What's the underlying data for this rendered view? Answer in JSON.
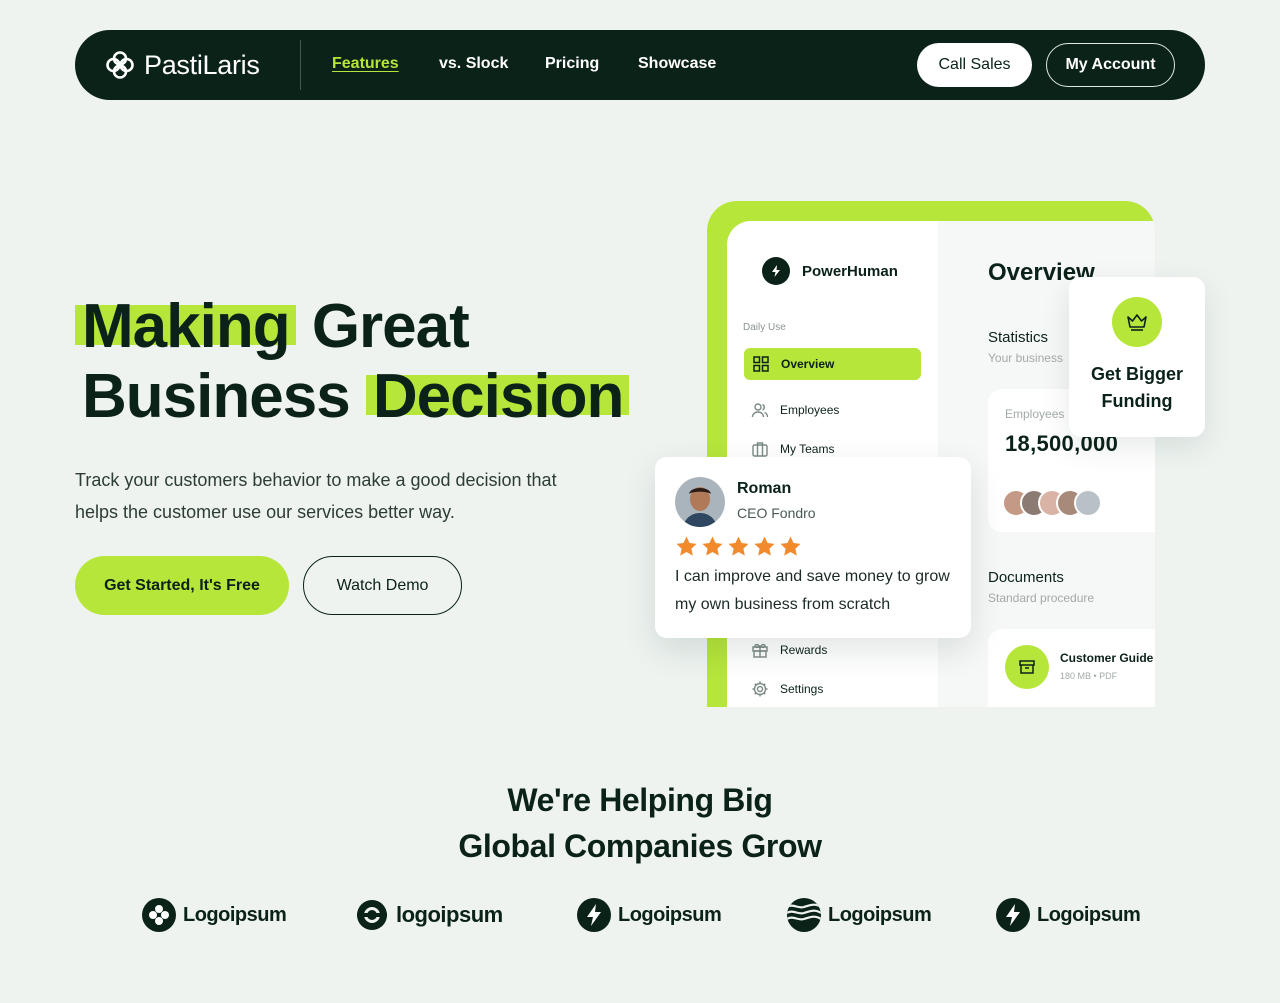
{
  "colors": {
    "accent": "#b6e63a",
    "dark": "#0b2219",
    "background": "#eef3f0",
    "star": "#f08a2c"
  },
  "nav": {
    "brand": "PastiLaris",
    "links": [
      "Features",
      "vs. Slock",
      "Pricing",
      "Showcase"
    ],
    "active_link": "Features",
    "call_sales": "Call Sales",
    "my_account": "My Account"
  },
  "hero": {
    "title_word1": "Making",
    "title_word2": "Great",
    "title_word3": "Business",
    "title_word4": "Decision",
    "description": "Track your customers behavior to make a good decision that helps the customer use our services better way.",
    "cta_primary": "Get Started, It's Free",
    "cta_secondary": "Watch Demo"
  },
  "dashboard": {
    "app_name": "PowerHuman",
    "section_label": "Daily Use",
    "menu": [
      {
        "label": "Overview",
        "icon": "grid-icon"
      },
      {
        "label": "Employees",
        "icon": "users-icon"
      },
      {
        "label": "My Teams",
        "icon": "briefcase-icon"
      },
      {
        "label": "Rewards",
        "icon": "gift-icon"
      },
      {
        "label": "Settings",
        "icon": "gear-icon"
      }
    ],
    "overview_title": "Overview",
    "statistics_title": "Statistics",
    "statistics_sub": "Your business",
    "employees_label": "Employees",
    "employees_value": "18,500,000",
    "documents_title": "Documents",
    "documents_sub": "Standard procedure",
    "document_name": "Customer Guide",
    "document_meta": "180 MB • PDF"
  },
  "funding_card": {
    "text": "Get Bigger Funding",
    "icon": "crown-icon"
  },
  "review": {
    "name": "Roman",
    "role": "CEO Fondro",
    "rating": 5,
    "text": "I can improve and save money to grow my own business from scratch"
  },
  "partners": {
    "heading_line1": "We're Helping Big",
    "heading_line2": "Global Companies Grow",
    "logos": [
      "Logoipsum",
      "logoipsum",
      "Logoipsum",
      "Logoipsum",
      "Logoipsum"
    ]
  }
}
